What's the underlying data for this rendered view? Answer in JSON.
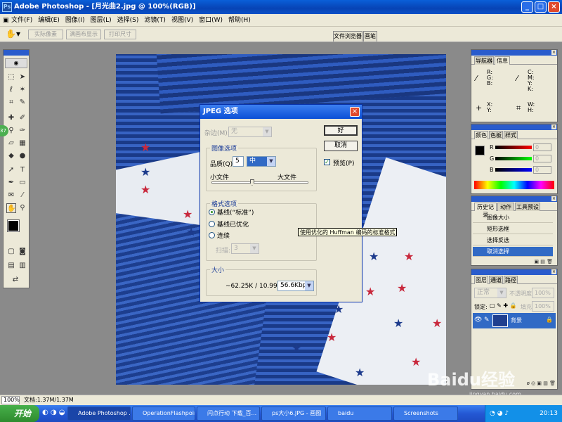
{
  "window": {
    "title": "Adobe Photoshop - [月光曲2.jpg @ 100%(RGB)]"
  },
  "menu": [
    "文件(F)",
    "编辑(E)",
    "图像(I)",
    "图层(L)",
    "选择(S)",
    "滤镜(T)",
    "视图(V)",
    "窗口(W)",
    "帮助(H)"
  ],
  "options": {
    "actual_pixels": "实际像素",
    "fit_screen": "满画布显示",
    "print_size": "打印尺寸"
  },
  "well_tabs": [
    "文件浏览器",
    "画笔"
  ],
  "dialog": {
    "title": "JPEG 选项",
    "matte_label": "杂边(M):",
    "matte_value": "无",
    "ok": "好",
    "cancel": "取消",
    "preview": "预览(P)",
    "image_options": {
      "title": "图像选项",
      "quality_label": "品质(Q):",
      "quality_value": "5",
      "quality_level": "中",
      "small_file": "小文件",
      "large_file": "大文件",
      "quality_fraction": 0.42
    },
    "format_options": {
      "title": "格式选项",
      "baseline": "基线(“标准”)",
      "optimized": "基线已优化",
      "progressive": "连续",
      "scans_label": "扫描:",
      "scans_value": "3"
    },
    "size": {
      "title": "大小",
      "estimate": "~62.25K / 10.99s @",
      "speed": "56.6Kbps"
    }
  },
  "tooltip": "使用优化的 Huffman 编码的标准格式",
  "navigator": {
    "tabs": [
      "导航器",
      "信息"
    ],
    "rgb": [
      "R:",
      "G:",
      "B:"
    ],
    "cmyk": [
      "C:",
      "M:",
      "Y:",
      "K:"
    ],
    "xy": [
      "X:",
      "Y:"
    ],
    "wh": [
      "W:",
      "H:"
    ]
  },
  "color_panel": {
    "tabs": [
      "颜色",
      "色板",
      "样式"
    ],
    "channels": [
      "R",
      "G",
      "B"
    ],
    "values": [
      "0",
      "0",
      "0"
    ]
  },
  "history": {
    "tabs": [
      "历史记录",
      "动作",
      "工具预设"
    ],
    "items": [
      "图像大小",
      "矩形选框",
      "选择反选",
      "取消选择"
    ]
  },
  "layers": {
    "tabs": [
      "图层",
      "通道",
      "路径"
    ],
    "blend_mode": "正常",
    "opacity_label": "不透明度:",
    "opacity": "100%",
    "lock_label": "锁定:",
    "fill_label": "填充:",
    "fill": "100%",
    "layer_name": "背景"
  },
  "statusbar": {
    "zoom": "100%",
    "doc": "文档:1.37M/1.37M"
  },
  "taskbar": {
    "start": "开始",
    "tasks": [
      "Adobe Photoshop ...",
      "OperationFlashpoint",
      "闪点行动 下载_百...",
      "ps大小6.JPG - 画图",
      "baidu",
      "Screenshots"
    ],
    "clock": "20:13"
  },
  "watermark": {
    "brand": "Baidu经验",
    "url": "jingyan.baidu.com"
  },
  "colors": {
    "accent": "#0a5fd8",
    "dialog_bg": "#ece9d8",
    "canvas_blue": "#17357e",
    "star_red": "#c8283c",
    "star_blue": "#1c3a8c"
  }
}
